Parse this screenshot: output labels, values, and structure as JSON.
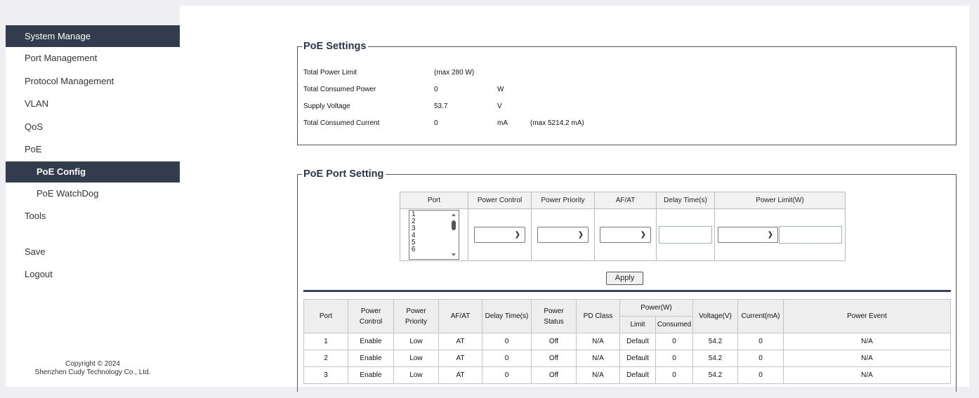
{
  "sidebar": {
    "items": [
      {
        "label": "System Manage"
      },
      {
        "label": "Port Management"
      },
      {
        "label": "Protocol Management"
      },
      {
        "label": "VLAN"
      },
      {
        "label": "QoS"
      },
      {
        "label": "PoE"
      },
      {
        "label": "PoE Config"
      },
      {
        "label": "PoE WatchDog"
      },
      {
        "label": "Tools"
      },
      {
        "label": "Save"
      },
      {
        "label": "Logout"
      }
    ],
    "copyright_line1": "Copyright © 2024",
    "copyright_line2": "Shenzhen Cudy Technology Co., Ltd."
  },
  "poe_settings": {
    "title": "PoE Settings",
    "rows": [
      {
        "label": "Total Power Limit",
        "value": "(max 280 W)",
        "unit": "",
        "extra": ""
      },
      {
        "label": "Total Consumed Power",
        "value": "0",
        "unit": "W",
        "extra": ""
      },
      {
        "label": "Supply Voltage",
        "value": "53.7",
        "unit": "V",
        "extra": ""
      },
      {
        "label": "Total Consumed Current",
        "value": "0",
        "unit": "mA",
        "extra": "(max 5214.2 mA)"
      }
    ]
  },
  "port_setting": {
    "title": "PoE Port Setting",
    "headers": [
      "Port",
      "Power Control",
      "Power Priority",
      "AF/AT",
      "Delay Time(s)",
      "Power Limit(W)"
    ],
    "port_list": [
      "1",
      "2",
      "3",
      "4",
      "5",
      "6"
    ],
    "apply_label": "Apply"
  },
  "status_table": {
    "headers": {
      "port": "Port",
      "power_control": "Power Control",
      "power_priority": "Power Priority",
      "afat": "AF/AT",
      "delay": "Delay Time(s)",
      "power_status": "Power Status",
      "pd_class": "PD Class",
      "power_w": "Power(W)",
      "limit": "Limit",
      "consumed": "Consumed",
      "voltage": "Voltage(V)",
      "current": "Current(mA)",
      "event": "Power Event"
    },
    "rows": [
      [
        "1",
        "Enable",
        "Low",
        "AT",
        "0",
        "Off",
        "N/A",
        "Default",
        "0",
        "54.2",
        "0",
        "N/A"
      ],
      [
        "2",
        "Enable",
        "Low",
        "AT",
        "0",
        "Off",
        "N/A",
        "Default",
        "0",
        "54.2",
        "0",
        "N/A"
      ],
      [
        "3",
        "Enable",
        "Low",
        "AT",
        "0",
        "Off",
        "N/A",
        "Default",
        "0",
        "54.2",
        "0",
        "N/A"
      ]
    ]
  }
}
